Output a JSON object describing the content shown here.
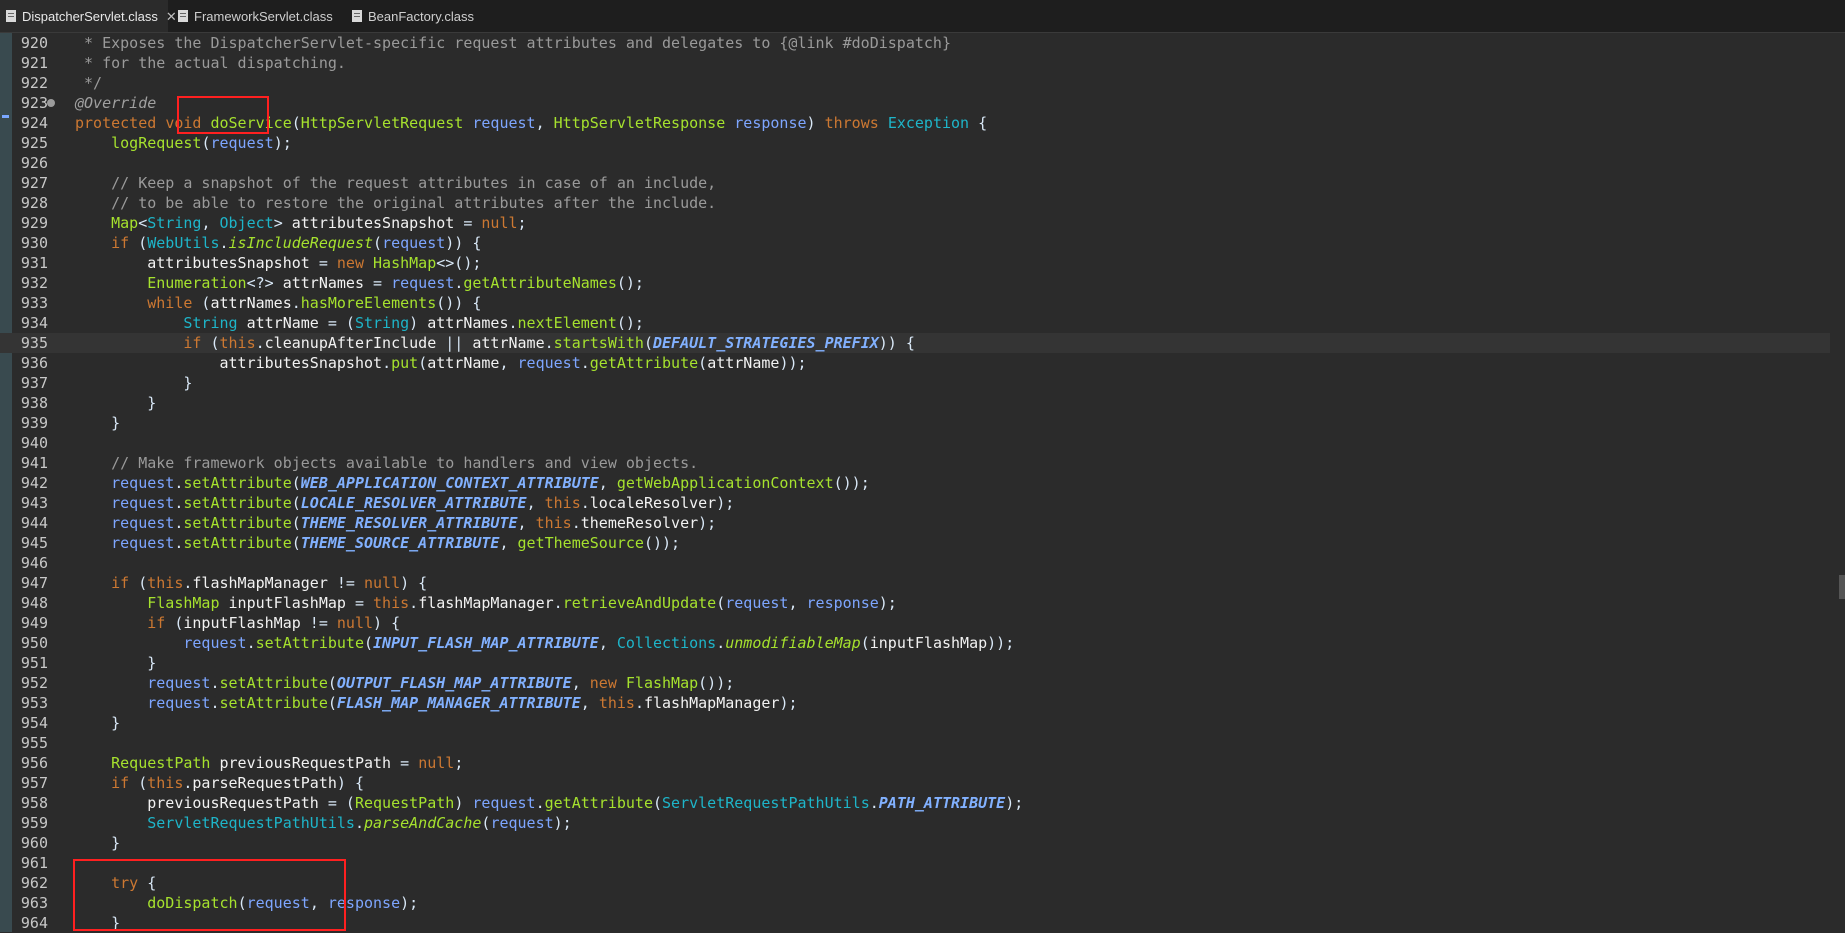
{
  "tabs": [
    {
      "label": "DispatcherServlet.class",
      "active": true,
      "closable": true,
      "icon": "class-file-icon"
    },
    {
      "label": "FrameworkServlet.class",
      "active": false,
      "closable": false,
      "icon": "class-file-icon"
    },
    {
      "label": "BeanFactory.class",
      "active": false,
      "closable": false,
      "icon": "class-file-icon"
    }
  ],
  "colors": {
    "background": "#2b2b2b",
    "keyword": "#cc7832",
    "method": "#a6e22e",
    "constant": "#82b1ff",
    "comment": "#9a9a9a",
    "highlight_box": "#ff2020"
  },
  "editor": {
    "current_line": 935,
    "lines": [
      {
        "n": "920",
        "text": " * Exposes the DispatcherServlet-specific request attributes and delegates to {@link #doDispatch}"
      },
      {
        "n": "921",
        "text": " * for the actual dispatching."
      },
      {
        "n": "922",
        "text": " */"
      },
      {
        "n": "923",
        "text": "@Override"
      },
      {
        "n": "924",
        "text": "protected void doService(HttpServletRequest request, HttpServletResponse response) throws Exception {"
      },
      {
        "n": "925",
        "text": "    logRequest(request);"
      },
      {
        "n": "926",
        "text": ""
      },
      {
        "n": "927",
        "text": "    // Keep a snapshot of the request attributes in case of an include,"
      },
      {
        "n": "928",
        "text": "    // to be able to restore the original attributes after the include."
      },
      {
        "n": "929",
        "text": "    Map<String, Object> attributesSnapshot = null;"
      },
      {
        "n": "930",
        "text": "    if (WebUtils.isIncludeRequest(request)) {"
      },
      {
        "n": "931",
        "text": "        attributesSnapshot = new HashMap<>();"
      },
      {
        "n": "932",
        "text": "        Enumeration<?> attrNames = request.getAttributeNames();"
      },
      {
        "n": "933",
        "text": "        while (attrNames.hasMoreElements()) {"
      },
      {
        "n": "934",
        "text": "            String attrName = (String) attrNames.nextElement();"
      },
      {
        "n": "935",
        "text": "            if (this.cleanupAfterInclude || attrName.startsWith(DEFAULT_STRATEGIES_PREFIX)) {"
      },
      {
        "n": "936",
        "text": "                attributesSnapshot.put(attrName, request.getAttribute(attrName));"
      },
      {
        "n": "937",
        "text": "            }"
      },
      {
        "n": "938",
        "text": "        }"
      },
      {
        "n": "939",
        "text": "    }"
      },
      {
        "n": "940",
        "text": ""
      },
      {
        "n": "941",
        "text": "    // Make framework objects available to handlers and view objects."
      },
      {
        "n": "942",
        "text": "    request.setAttribute(WEB_APPLICATION_CONTEXT_ATTRIBUTE, getWebApplicationContext());"
      },
      {
        "n": "943",
        "text": "    request.setAttribute(LOCALE_RESOLVER_ATTRIBUTE, this.localeResolver);"
      },
      {
        "n": "944",
        "text": "    request.setAttribute(THEME_RESOLVER_ATTRIBUTE, this.themeResolver);"
      },
      {
        "n": "945",
        "text": "    request.setAttribute(THEME_SOURCE_ATTRIBUTE, getThemeSource());"
      },
      {
        "n": "946",
        "text": ""
      },
      {
        "n": "947",
        "text": "    if (this.flashMapManager != null) {"
      },
      {
        "n": "948",
        "text": "        FlashMap inputFlashMap = this.flashMapManager.retrieveAndUpdate(request, response);"
      },
      {
        "n": "949",
        "text": "        if (inputFlashMap != null) {"
      },
      {
        "n": "950",
        "text": "            request.setAttribute(INPUT_FLASH_MAP_ATTRIBUTE, Collections.unmodifiableMap(inputFlashMap));"
      },
      {
        "n": "951",
        "text": "        }"
      },
      {
        "n": "952",
        "text": "        request.setAttribute(OUTPUT_FLASH_MAP_ATTRIBUTE, new FlashMap());"
      },
      {
        "n": "953",
        "text": "        request.setAttribute(FLASH_MAP_MANAGER_ATTRIBUTE, this.flashMapManager);"
      },
      {
        "n": "954",
        "text": "    }"
      },
      {
        "n": "955",
        "text": ""
      },
      {
        "n": "956",
        "text": "    RequestPath previousRequestPath = null;"
      },
      {
        "n": "957",
        "text": "    if (this.parseRequestPath) {"
      },
      {
        "n": "958",
        "text": "        previousRequestPath = (RequestPath) request.getAttribute(ServletRequestPathUtils.PATH_ATTRIBUTE);"
      },
      {
        "n": "959",
        "text": "        ServletRequestPathUtils.parseAndCache(request);"
      },
      {
        "n": "960",
        "text": "    }"
      },
      {
        "n": "961",
        "text": ""
      },
      {
        "n": "962",
        "text": "    try {"
      },
      {
        "n": "963",
        "text": "        doDispatch(request, response);"
      },
      {
        "n": "964",
        "text": "    }"
      }
    ]
  }
}
